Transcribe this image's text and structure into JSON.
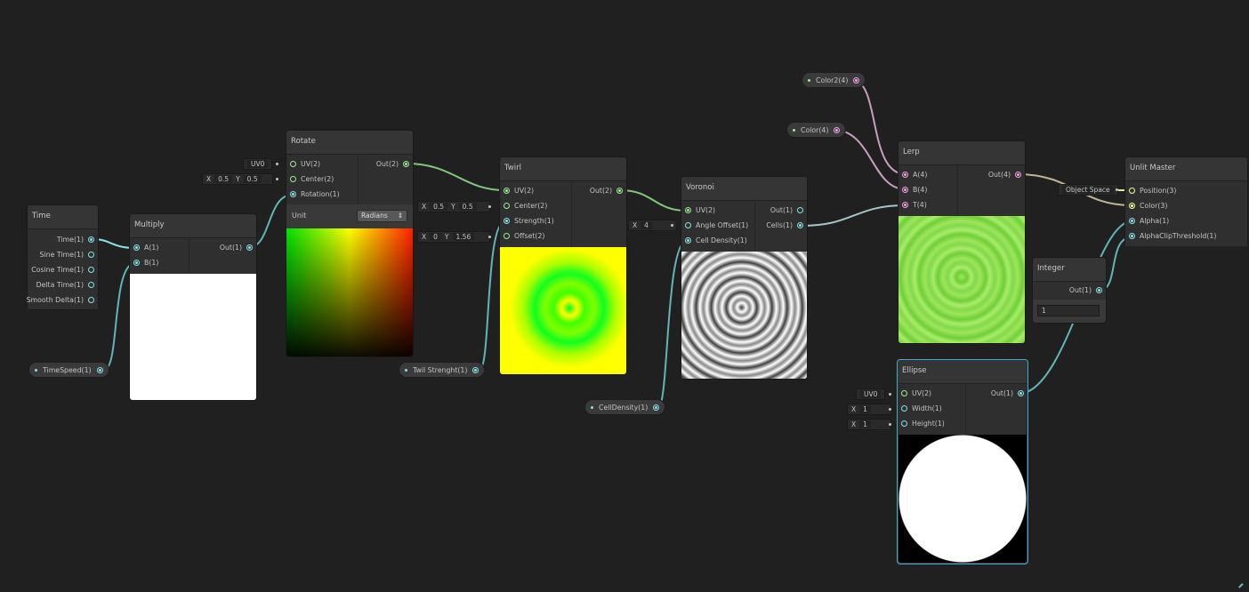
{
  "nodes": {
    "time": {
      "title": "Time",
      "outputs": [
        "Time(1)",
        "Sine Time(1)",
        "Cosine Time(1)",
        "Delta Time(1)",
        "Smooth Delta(1)"
      ]
    },
    "multiply": {
      "title": "Multiply",
      "inputs": [
        "A(1)",
        "B(1)"
      ],
      "output": "Out(1)"
    },
    "rotate": {
      "title": "Rotate",
      "inputs": [
        "UV(2)",
        "Center(2)",
        "Rotation(1)"
      ],
      "output": "Out(2)",
      "unit_label": "Unit",
      "unit_value": "Radians",
      "uv_channel": "UV0",
      "center_x_label": "X",
      "center_x": "0.5",
      "center_y_label": "Y",
      "center_y": "0.5"
    },
    "twirl": {
      "title": "Twirl",
      "inputs": [
        "UV(2)",
        "Center(2)",
        "Strength(1)",
        "Offset(2)"
      ],
      "output": "Out(2)",
      "center_x_label": "X",
      "center_x": "0.5",
      "center_y_label": "Y",
      "center_y": "0.5",
      "offset_x_label": "X",
      "offset_x": "0",
      "offset_y_label": "Y",
      "offset_y": "1.56"
    },
    "voronoi": {
      "title": "Voronoi",
      "inputs": [
        "UV(2)",
        "Angle Offset(1)",
        "Cell Density(1)"
      ],
      "outputs": [
        "Out(1)",
        "Cells(1)"
      ],
      "angle_x_label": "X",
      "angle_x": "4"
    },
    "lerp": {
      "title": "Lerp",
      "inputs": [
        "A(4)",
        "B(4)",
        "T(4)"
      ],
      "output": "Out(4)"
    },
    "unlit": {
      "title": "Unlit Master",
      "inputs": [
        "Position(3)",
        "Color(3)",
        "Alpha(1)",
        "AlphaClipThreshold(1)"
      ],
      "space": "Object Space"
    },
    "integer": {
      "title": "Integer",
      "output": "Out(1)",
      "value": "1"
    },
    "ellipse": {
      "title": "Ellipse",
      "inputs": [
        "UV(2)",
        "Width(1)",
        "Height(1)"
      ],
      "output": "Out(1)",
      "uv_channel": "UV0",
      "width_label": "X",
      "width": "1",
      "height_label": "X",
      "height": "1"
    }
  },
  "properties": {
    "time_speed": "TimeSpeed(1)",
    "twirl_strength": "Twil Strenght(1)",
    "cell_density": "CellDensity(1)",
    "color": "Color(4)",
    "color2": "Color2(4)"
  },
  "colors": {
    "wire_float": "#84e4e7",
    "wire_vec2": "#9aef92",
    "wire_vec4": "#f1a1e4",
    "wire_vec3": "#f6ff9a",
    "background": "#202020"
  }
}
